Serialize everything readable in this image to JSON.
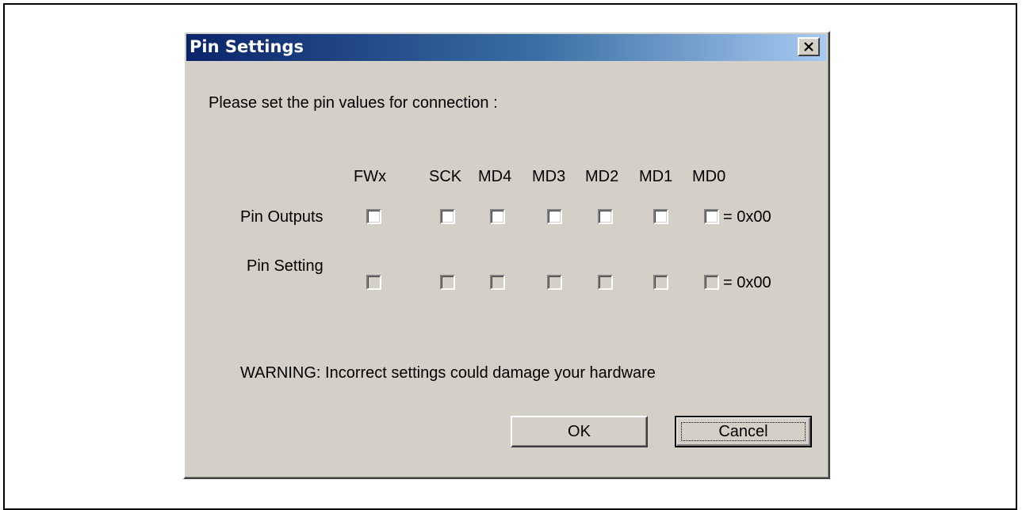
{
  "dialog": {
    "title": "Pin Settings",
    "close_label": "×",
    "prompt": "Please set the pin values for connection :",
    "columns": [
      "FWx",
      "SCK",
      "MD4",
      "MD3",
      "MD2",
      "MD1",
      "MD0"
    ],
    "rows": [
      {
        "label": "Pin Outputs",
        "checked": [
          false,
          false,
          false,
          false,
          false,
          false,
          false
        ],
        "enabled": true,
        "value": "= 0x00"
      },
      {
        "label": "Pin Setting",
        "checked": [
          false,
          false,
          false,
          false,
          false,
          false,
          false
        ],
        "enabled": false,
        "value": "= 0x00"
      }
    ],
    "warning": "WARNING: Incorrect settings could damage your hardware",
    "ok_label": "OK",
    "cancel_label": "Cancel"
  },
  "colors": {
    "face": "#d4d0c8",
    "title_start": "#0a246a",
    "title_end": "#a6caf0"
  }
}
